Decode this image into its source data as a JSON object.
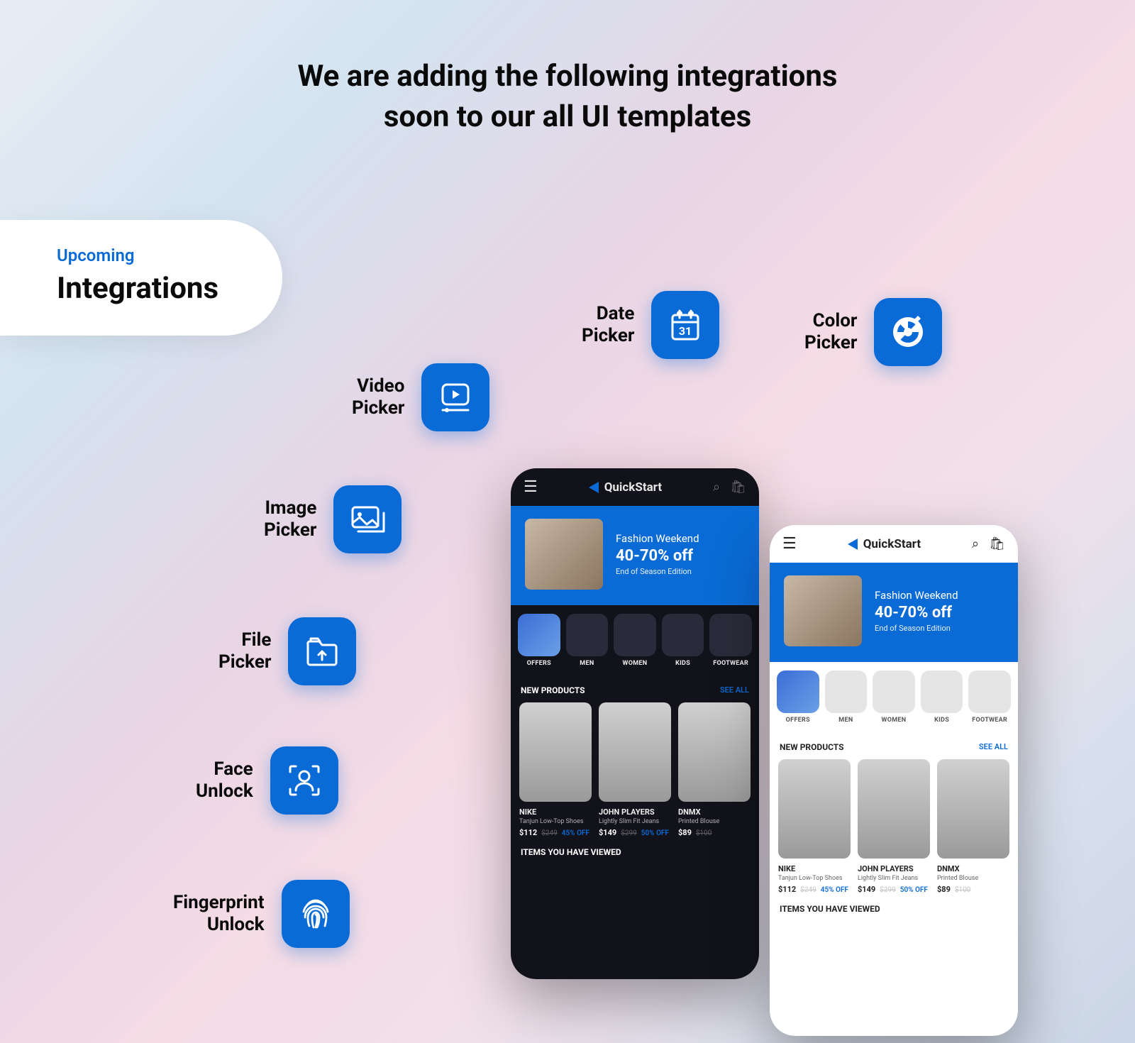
{
  "headline_line1": "We are adding the following integrations",
  "headline_line2": "soon to our all UI templates",
  "pill": {
    "upcoming": "Upcoming",
    "title": "Integrations"
  },
  "features": {
    "video": "Video\nPicker",
    "date": "Date\nPicker",
    "color": "Color\nPicker",
    "image": "Image\nPicker",
    "file": "File\nPicker",
    "face": "Face\nUnlock",
    "finger": "Fingerprint\nUnlock"
  },
  "phone": {
    "brand": "QuickStart",
    "hero": {
      "line1": "Fashion Weekend",
      "line2": "40-70% off",
      "line3": "End of Season Edition"
    },
    "cats": [
      "OFFERS",
      "MEN",
      "WOMEN",
      "KIDS",
      "FOOTWEAR"
    ],
    "sec1": "NEW PRODUCTS",
    "see_all": "SEE ALL",
    "sec2": "ITEMS YOU HAVE VIEWED",
    "products": [
      {
        "brand": "NIKE",
        "name": "Tanjun Low-Top Shoes",
        "price": "$112",
        "old": "$249",
        "disc": "45% OFF"
      },
      {
        "brand": "JOHN PLAYERS",
        "name": "Lightly Slim Fit Jeans",
        "price": "$149",
        "old": "$299",
        "disc": "50% OFF"
      },
      {
        "brand": "DNMX",
        "name": "Printed Blouse",
        "price": "$89",
        "old": "$100",
        "disc": ""
      }
    ]
  }
}
